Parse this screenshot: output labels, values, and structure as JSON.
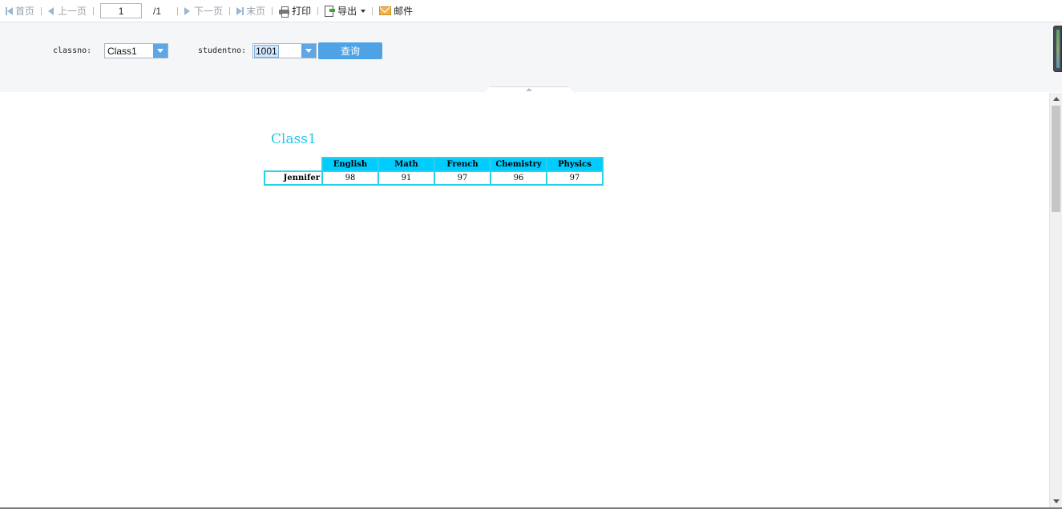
{
  "toolbar": {
    "first": "首页",
    "prev": "上一页",
    "page_value": "1",
    "page_total": "/1",
    "next": "下一页",
    "last": "末页",
    "print": "打印",
    "export": "导出",
    "mail": "邮件"
  },
  "params": {
    "classno_label": "classno:",
    "classno_value": "Class1",
    "studentno_label": "studentno:",
    "studentno_value": "1001",
    "query_label": "查询"
  },
  "report": {
    "title": "Class1",
    "columns": [
      "English",
      "Math",
      "French",
      "Chemistry",
      "Physics"
    ],
    "rows": [
      {
        "name": "Jennifer",
        "scores": [
          "98",
          "91",
          "97",
          "96",
          "97"
        ]
      }
    ]
  },
  "colors": {
    "title": "#22c7e6",
    "header_bg": "#00ccff",
    "table_border": "#25d4ec",
    "button": "#4ea3e6"
  }
}
